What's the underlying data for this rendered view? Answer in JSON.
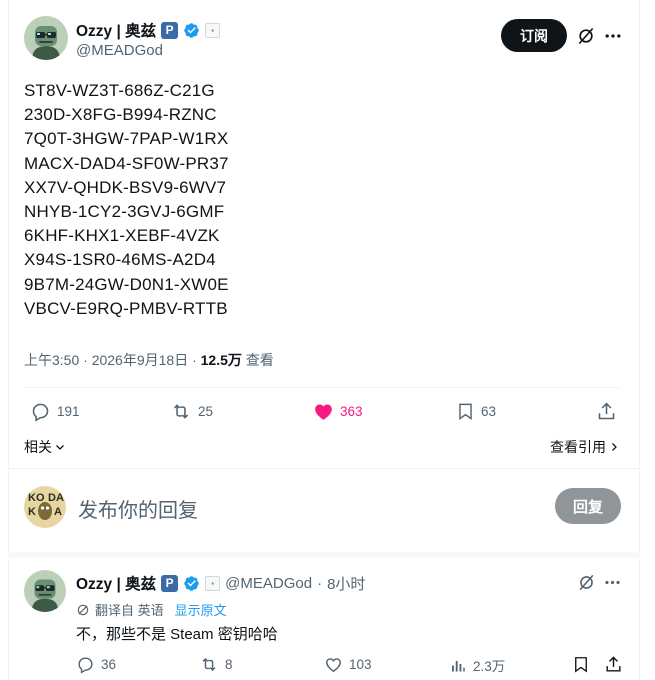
{
  "main_tweet": {
    "display_name": "Ozzy | 奥兹",
    "badge_letter": "P",
    "handle": "@MEADGod",
    "follow_label": "订阅",
    "codes": [
      "ST8V-WZ3T-686Z-C21G",
      "230D-X8FG-B994-RZNC",
      "7Q0T-3HGW-7PAP-W1RX",
      "MACX-DAD4-SF0W-PR37",
      "XX7V-QHDK-BSV9-6WV7",
      "NHYB-1CY2-3GVJ-6GMF",
      "6KHF-KHX1-XEBF-4VZK",
      "X94S-1SR0-46MS-A2D4",
      "9B7M-24GW-D0N1-XW0E",
      "VBCV-E9RQ-PMBV-RTTB"
    ],
    "timestamp": "上午3:50 · 2026年9月18日 · ",
    "views": "12.5万",
    "views_label": " 查看",
    "actions": {
      "replies": "191",
      "retweets": "25",
      "likes": "363",
      "bookmarks": "63"
    },
    "related_label": "相关",
    "quotes_label": "查看引用"
  },
  "compose": {
    "placeholder": "发布你的回复",
    "reply_button": "回复"
  },
  "reply_tweet": {
    "display_name": "Ozzy | 奥兹",
    "badge_letter": "P",
    "handle": "@MEADGod",
    "separator": "·",
    "time": "8小时",
    "translated_from": "翻译自 英语",
    "show_original": "显示原文",
    "text": "不，那些不是 Steam 密钥哈哈",
    "actions": {
      "replies": "36",
      "retweets": "8",
      "likes": "103",
      "views": "2.3万"
    }
  },
  "colors": {
    "accent": "#1d9bf0",
    "like": "#f91880",
    "muted": "#536471",
    "text": "#0f1419"
  }
}
